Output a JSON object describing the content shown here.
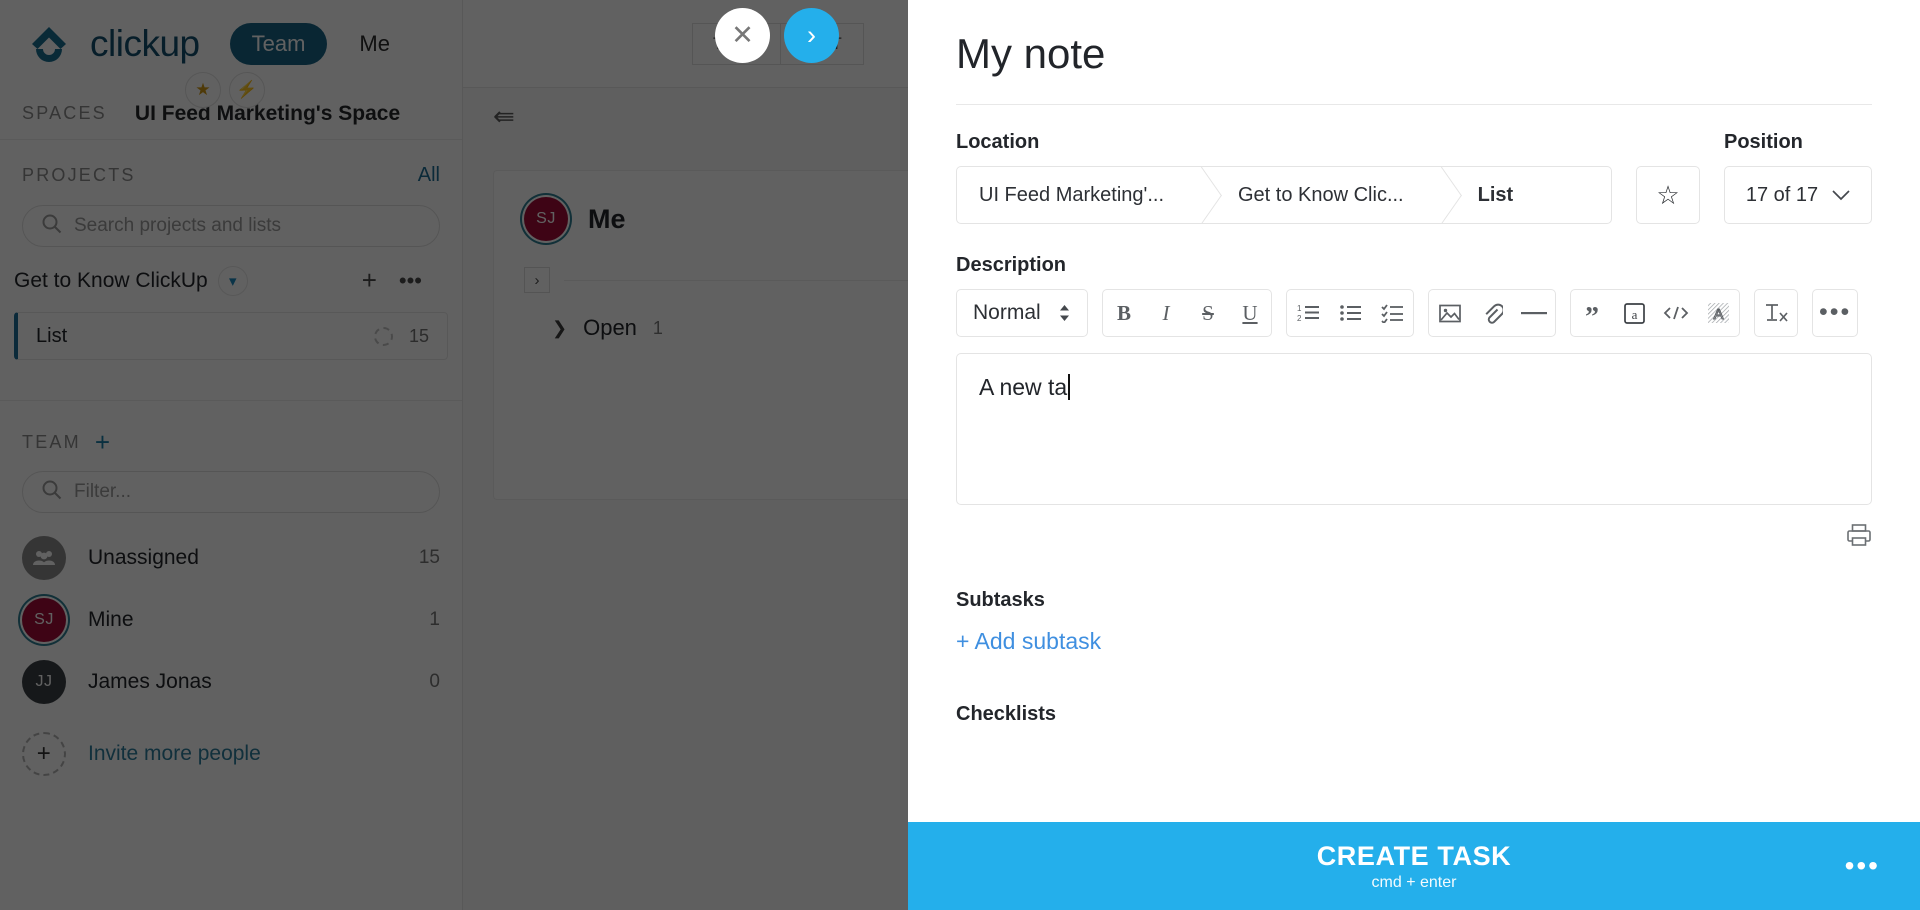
{
  "app": {
    "brand": "clickup",
    "nav": {
      "team": "Team",
      "me": "Me"
    },
    "badges": {
      "star": "★",
      "bolt": "⚡"
    }
  },
  "sidebar": {
    "spaces_label": "SPACES",
    "space_name": "UI Feed Marketing's Space",
    "projects_label": "PROJECTS",
    "projects_all": "All",
    "project_search_placeholder": "Search projects and lists",
    "project": {
      "name": "Get to Know ClickUp",
      "add": "+",
      "more": "•••"
    },
    "list": {
      "name": "List",
      "count": "15"
    },
    "team_label": "TEAM",
    "team_add": "+",
    "team_filter_placeholder": "Filter...",
    "people": [
      {
        "initials": "",
        "name": "Unassigned",
        "count": "15",
        "style": "grey"
      },
      {
        "initials": "SJ",
        "name": "Mine",
        "count": "1",
        "style": "maroon"
      },
      {
        "initials": "JJ",
        "name": "James Jonas",
        "count": "0",
        "style": "dark"
      }
    ],
    "invite": {
      "icon": "+",
      "label": "Invite more people"
    }
  },
  "main": {
    "tabs": [
      "TIME",
      "LIST"
    ],
    "group_title": "Me",
    "group_avatar": "SJ",
    "status": {
      "label": "Open",
      "count": "1"
    }
  },
  "float_buttons": {
    "close": "✕",
    "next": "›"
  },
  "panel": {
    "title": "My note",
    "location_label": "Location",
    "breadcrumbs": [
      {
        "label": "UI Feed Marketing'...",
        "current": false
      },
      {
        "label": "Get to Know Clic...",
        "current": false
      },
      {
        "label": "List",
        "current": true
      }
    ],
    "favorite_icon": "☆",
    "position_label": "Position",
    "position_value": "17 of 17",
    "description_label": "Description",
    "toolbar": {
      "style_value": "Normal",
      "groups": [
        [
          "bold",
          "italic",
          "strikethrough",
          "underline"
        ],
        [
          "ordered-list",
          "bullet-list",
          "checklist"
        ],
        [
          "image",
          "attachment",
          "horizontal-rule"
        ],
        [
          "blockquote",
          "mention",
          "code",
          "banner"
        ],
        [
          "clear-format"
        ],
        [
          "more-options"
        ]
      ]
    },
    "description_text": "A new ta",
    "print_icon": "print",
    "subtasks_label": "Subtasks",
    "add_subtask": "+ Add subtask",
    "checklist_label": "Checklists",
    "create_button": "CREATE TASK",
    "create_shortcut": "cmd + enter",
    "create_more": "•••"
  },
  "colors": {
    "accent_blue": "#24afeb",
    "brand_dark_blue": "#1a6486",
    "link_blue": "#3f8fe0",
    "avatar_maroon": "#a30d38"
  }
}
